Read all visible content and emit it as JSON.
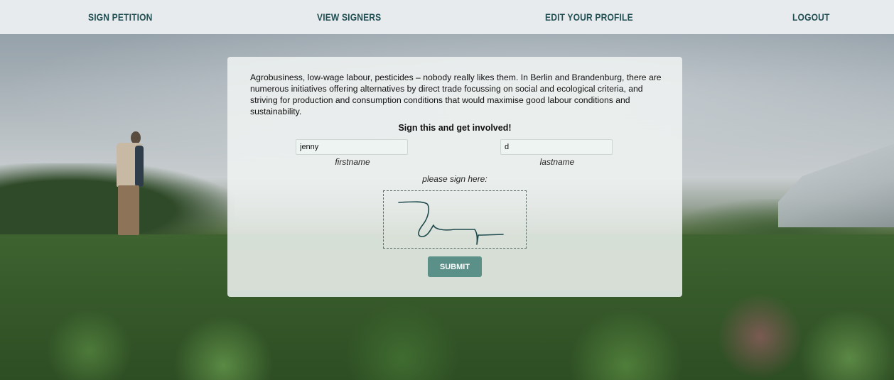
{
  "nav": {
    "items": [
      {
        "label": "SIGN PETITION"
      },
      {
        "label": "VIEW SIGNERS"
      },
      {
        "label": "EDIT YOUR PROFILE"
      },
      {
        "label": "LOGOUT"
      }
    ]
  },
  "petition": {
    "intro": "Agrobusiness, low-wage labour, pesticides – nobody really likes them. In Berlin and Brandenburg, there are numerous initiatives offering alternatives by direct trade focussing on social and ecological criteria, and striving for production and consumption conditions that would maximise good labour conditions and sustainability.",
    "cta": "Sign this and get involved!",
    "firstname": {
      "value": "jenny",
      "label": "firstname"
    },
    "lastname": {
      "value": "d",
      "label": "lastname"
    },
    "signature_label": "please sign here:",
    "submit_label": "SUBMIT"
  },
  "colors": {
    "nav_bg": "#e8ebee",
    "nav_text": "#1f4e52",
    "button_bg": "#5b9088",
    "signature_stroke": "#1f4a4c"
  }
}
